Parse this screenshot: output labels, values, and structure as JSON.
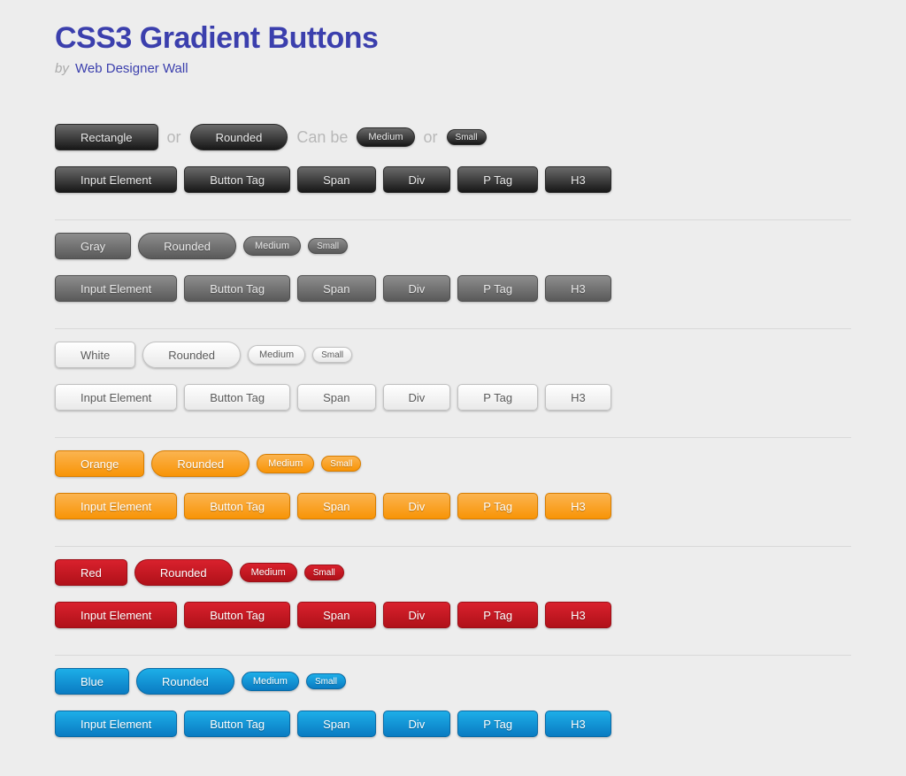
{
  "title": "CSS3 Gradient Buttons",
  "byline_prefix": "by",
  "byline_author": "Web Designer Wall",
  "connectors": {
    "or": "or",
    "can_be": "Can be"
  },
  "labels": {
    "rectangle": "Rectangle",
    "rounded": "Rounded",
    "medium": "Medium",
    "small": "Small",
    "input_element": "Input Element",
    "button_tag": "Button Tag",
    "span": "Span",
    "div": "Div",
    "p_tag": "P Tag",
    "h3": "H3",
    "gray": "Gray",
    "white": "White",
    "orange": "Orange",
    "red": "Red",
    "blue": "Blue"
  }
}
